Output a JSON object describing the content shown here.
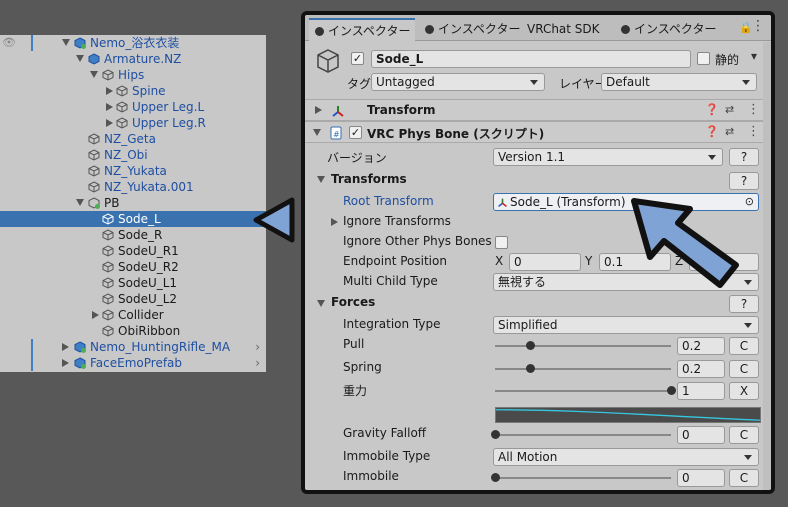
{
  "hierarchy": {
    "items": [
      {
        "label": "Nemo_浴衣衣装",
        "depth": 0
      },
      {
        "label": "Armature.NZ",
        "depth": 1
      },
      {
        "label": "Hips",
        "depth": 2
      },
      {
        "label": "Spine",
        "depth": 3
      },
      {
        "label": "Upper Leg.L",
        "depth": 3
      },
      {
        "label": "Upper Leg.R",
        "depth": 3
      },
      {
        "label": "NZ_Geta",
        "depth": 1
      },
      {
        "label": "NZ_Obi",
        "depth": 1
      },
      {
        "label": "NZ_Yukata",
        "depth": 1
      },
      {
        "label": "NZ_Yukata.001",
        "depth": 1
      },
      {
        "label": "PB",
        "depth": 1
      },
      {
        "label": "Sode_L",
        "depth": 2
      },
      {
        "label": "Sode_R",
        "depth": 2
      },
      {
        "label": "SodeU_R1",
        "depth": 2
      },
      {
        "label": "SodeU_R2",
        "depth": 2
      },
      {
        "label": "SodeU_L1",
        "depth": 2
      },
      {
        "label": "SodeU_L2",
        "depth": 2
      },
      {
        "label": "Collider",
        "depth": 2
      },
      {
        "label": "ObiRibbon",
        "depth": 2
      },
      {
        "label": "Nemo_HuntingRifle_MA",
        "depth": 0
      },
      {
        "label": "FaceEmoPrefab",
        "depth": 0
      }
    ]
  },
  "tabs": [
    "インスペクター",
    "インスペクター",
    "VRChat SDK",
    "インスペクター"
  ],
  "object": {
    "name": "Sode_L",
    "static_label": "静的",
    "tag_label": "タグ",
    "tag_value": "Untagged",
    "layer_label": "レイヤー",
    "layer_value": "Default"
  },
  "components": {
    "transform_title": "Transform",
    "physbone_title": "VRC Phys Bone (スクリプト)"
  },
  "physbone": {
    "version_label": "バージョン",
    "version_value": "Version 1.1",
    "help": "?",
    "transforms_header": "Transforms",
    "root_transform_label": "Root Transform",
    "root_transform_value": "Sode_L (Transform)",
    "ignore_transforms_label": "Ignore Transforms",
    "ignore_other_label": "Ignore Other Phys Bones",
    "endpoint_label": "Endpoint Position",
    "endpoint_x_label": "X",
    "endpoint_x": "0",
    "endpoint_y_label": "Y",
    "endpoint_y": "0.1",
    "endpoint_z_label": "Z",
    "multi_child_label": "Multi Child Type",
    "multi_child_value": "無視する",
    "forces_header": "Forces",
    "integration_label": "Integration Type",
    "integration_value": "Simplified",
    "pull_label": "Pull",
    "pull_value": "0.2",
    "pull_fraction": 0.2,
    "spring_label": "Spring",
    "spring_value": "0.2",
    "spring_fraction": 0.2,
    "gravity_label": "重力",
    "gravity_value": "1",
    "gravity_fraction": 1.0,
    "gravity_falloff_label": "Gravity Falloff",
    "gravity_falloff_value": "0",
    "gravity_falloff_fraction": 0.0,
    "immobile_type_label": "Immobile Type",
    "immobile_type_value": "All Motion",
    "immobile_label": "Immobile",
    "immobile_value": "0",
    "immobile_fraction": 0.0,
    "c_button": "C",
    "x_button": "X"
  },
  "colors": {
    "selection": "#3a72b0",
    "arrow_fill": "#7fa3d4",
    "link_blue": "#1f4fa0"
  }
}
